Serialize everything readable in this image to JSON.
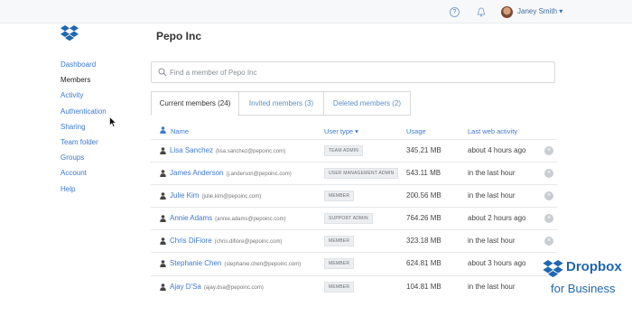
{
  "topbar": {
    "help_glyph": "?",
    "user_name": "Janey Smith",
    "user_caret": "▾"
  },
  "sidebar": {
    "items": [
      {
        "label": "Dashboard"
      },
      {
        "label": "Members"
      },
      {
        "label": "Activity"
      },
      {
        "label": "Authentication"
      },
      {
        "label": "Sharing"
      },
      {
        "label": "Team folder"
      },
      {
        "label": "Groups"
      },
      {
        "label": "Account"
      },
      {
        "label": "Help"
      }
    ],
    "active": "Members"
  },
  "page": {
    "title": "Pepo Inc"
  },
  "search": {
    "placeholder": "Find a member of Pepo Inc"
  },
  "tabs": [
    {
      "label": "Current members (24)"
    },
    {
      "label": "Invited members (3)"
    },
    {
      "label": "Deleted members (2)"
    }
  ],
  "table": {
    "headers": {
      "name": "Name",
      "user_type": "User type ▾",
      "usage": "Usage",
      "last_activity": "Last web activity"
    },
    "rows": [
      {
        "name": "Lisa Sanchez",
        "email": "(lisa.sanchez@pepoinc.com)",
        "type": "TEAM ADMIN",
        "usage": "345.21 MB",
        "activity": "about 4 hours ago"
      },
      {
        "name": "James Anderson",
        "email": "(j.anderson@pepoinc.com)",
        "type": "USER MANAGEMENT ADMIN",
        "usage": "543.11 MB",
        "activity": "in the last hour"
      },
      {
        "name": "Julie Kim",
        "email": "(julie.kim@pepoinc.com)",
        "type": "MEMBER",
        "usage": "200.56 MB",
        "activity": "in the last hour"
      },
      {
        "name": "Annie Adams",
        "email": "(annie.adams@pepoinc.com)",
        "type": "SUPPORT ADMIN",
        "usage": "764.26 MB",
        "activity": "about 2 hours ago"
      },
      {
        "name": "Chris DiFiore",
        "email": "(chris.difiore@pepoinc.com)",
        "type": "MEMBER",
        "usage": "323.18 MB",
        "activity": "in the last hour"
      },
      {
        "name": "Stephanie Chen",
        "email": "(stephanie.chen@pepoinc.com)",
        "type": "MEMBER",
        "usage": "624.81 MB",
        "activity": "about 3 hours ago"
      },
      {
        "name": "Ajay D'Sa",
        "email": "(ajay.dsa@pepoinc.com)",
        "type": "MEMBER",
        "usage": "104.81 MB",
        "activity": "in the last hour"
      }
    ]
  },
  "brand": {
    "name": "Dropbox",
    "subtitle": "for Business"
  },
  "icons": [
    "help-icon",
    "bell-icon",
    "avatar",
    "dropbox-logo-icon",
    "search-icon",
    "person-icon",
    "remove-icon",
    "mouse-cursor-icon"
  ],
  "colors": {
    "link": "#3d7ad0",
    "brand": "#1f67b1",
    "badge_bg": "#eceef0"
  }
}
